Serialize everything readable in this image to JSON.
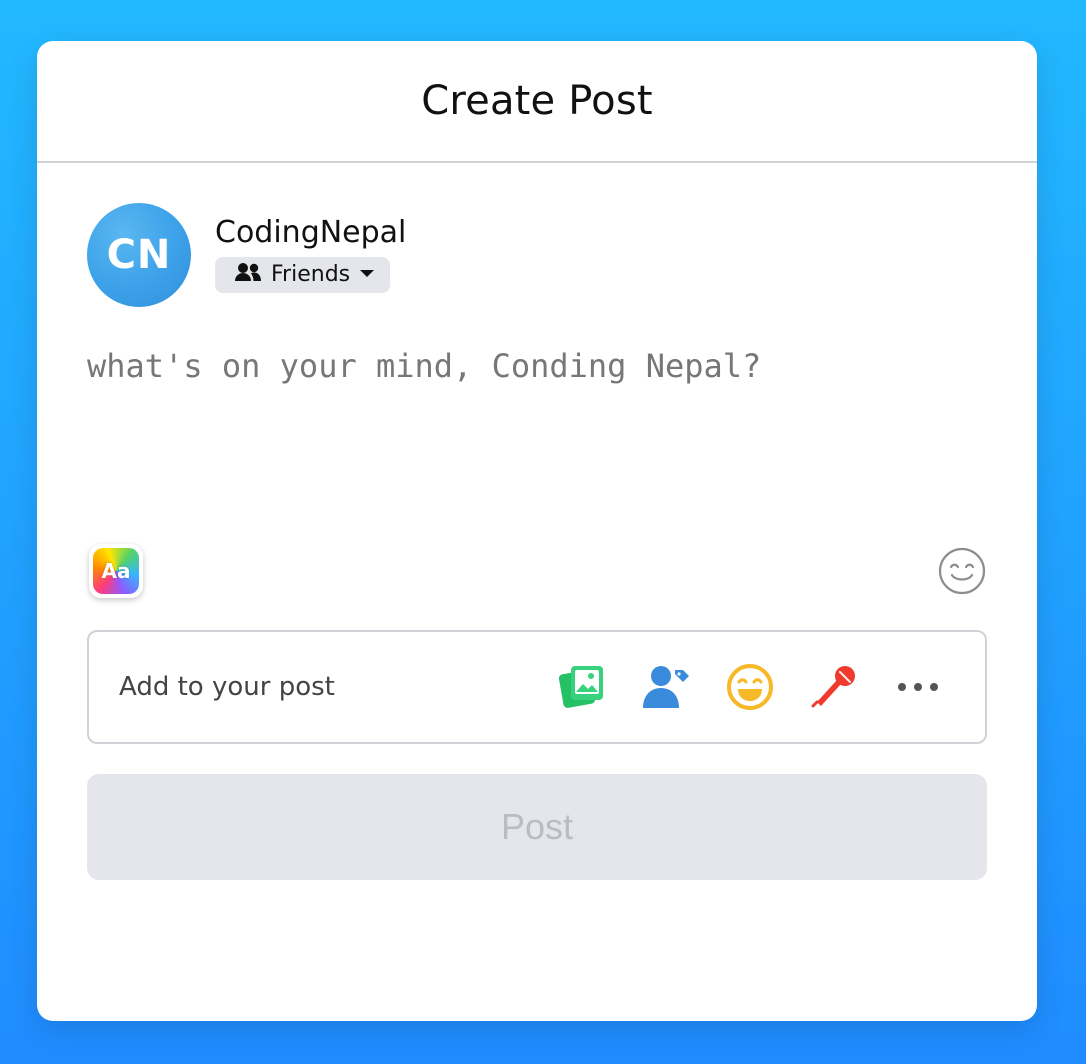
{
  "header": {
    "title": "Create Post"
  },
  "user": {
    "avatar_initials": "CN",
    "name": "CodingNepal",
    "privacy_label": "Friends"
  },
  "composer": {
    "placeholder": "what's on your mind, Conding Nepal?"
  },
  "tools": {
    "theme_label": "Aa"
  },
  "add_to_post": {
    "label": "Add to your post",
    "icons": [
      "photo-gallery-icon",
      "tag-people-icon",
      "feeling-icon",
      "mic-icon",
      "more-icon"
    ]
  },
  "actions": {
    "post_label": "Post"
  },
  "colors": {
    "background_top": "#22b8ff",
    "background_bottom": "#1f8cff",
    "disabled_button": "#e4e6eb",
    "photo_icon": "#2ecc71",
    "tag_icon": "#3a8bdc",
    "feeling_icon": "#f7b928",
    "mic_icon": "#f03a2e"
  }
}
